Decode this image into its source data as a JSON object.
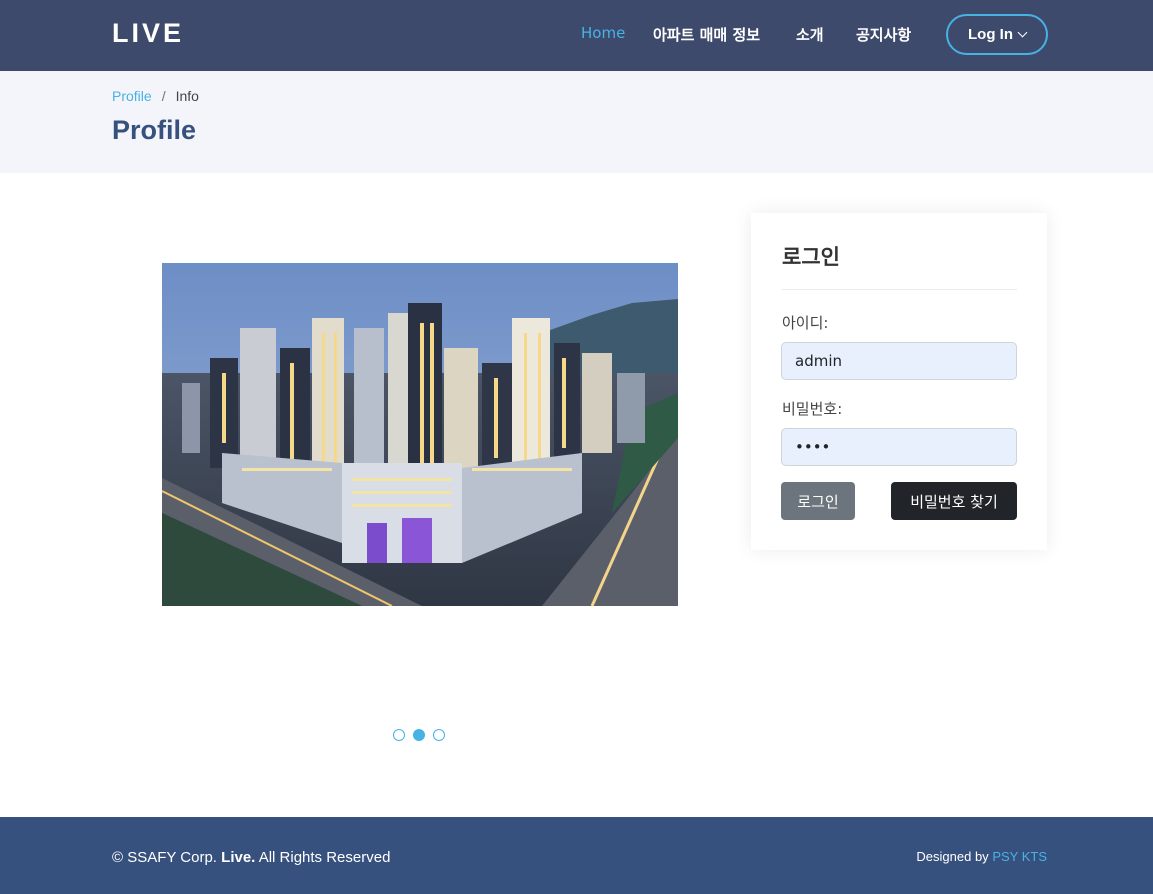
{
  "header": {
    "logo": "LIVE",
    "nav": [
      {
        "label": "Home",
        "active": true
      },
      {
        "label": "아파트 매매 정보",
        "active": false
      },
      {
        "label": "소개",
        "active": false
      },
      {
        "label": "공지사항",
        "active": false
      }
    ],
    "login_button": "Log In",
    "login_icon": "chevron-down-icon"
  },
  "breadcrumb": {
    "items": [
      "Profile",
      "Info"
    ],
    "separator": "/"
  },
  "page_title": "Profile",
  "carousel": {
    "slide_count": 3,
    "active_index": 1,
    "image_subject": "apartment-complex-night-aerial"
  },
  "login_card": {
    "title": "로그인",
    "id_label": "아이디:",
    "id_value": "admin",
    "password_label": "비밀번호:",
    "password_value": "1234",
    "login_button": "로그인",
    "find_password_button": "비밀번호 찾기"
  },
  "footer": {
    "copyright_prefix": "© SSAFY Corp.",
    "copyright_brand": "Live.",
    "copyright_suffix": "All Rights Reserved",
    "designed_prefix": "Designed by",
    "designed_credit": "PSY KTS"
  },
  "colors": {
    "header_bg": "#3d4a6b",
    "accent": "#47b2e4",
    "title": "#37517e",
    "footer_bg": "#37517e",
    "band_bg": "#f3f5fa"
  }
}
